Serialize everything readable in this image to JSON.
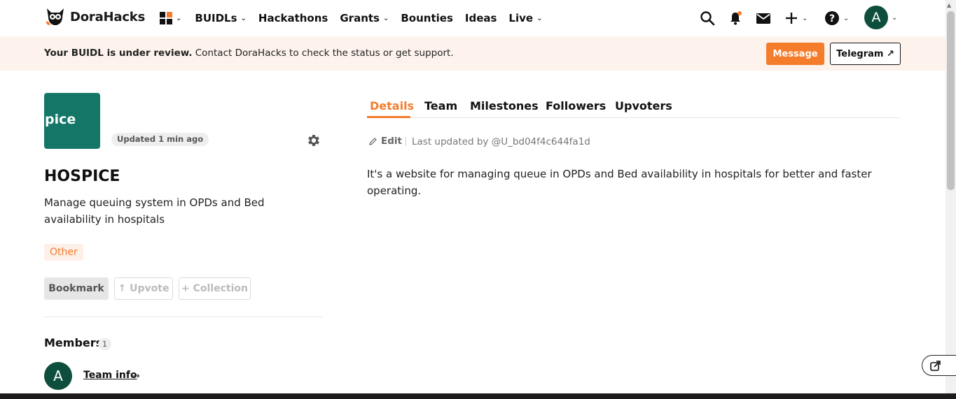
{
  "header": {
    "logo_text": "DoraHacks",
    "nav": [
      {
        "label": "BUIDLs",
        "has_dropdown": true
      },
      {
        "label": "Hackathons",
        "has_dropdown": false
      },
      {
        "label": "Grants",
        "has_dropdown": true
      },
      {
        "label": "Bounties",
        "has_dropdown": false
      },
      {
        "label": "Ideas",
        "has_dropdown": false
      },
      {
        "label": "Live",
        "has_dropdown": true
      }
    ],
    "avatar_initial": "A",
    "icons": [
      "apps-grid-icon",
      "search-icon",
      "notification-bell-icon",
      "mail-icon",
      "plus-icon",
      "help-icon"
    ]
  },
  "banner": {
    "bold_text": "Your BUIDL is under review.",
    "text": " Contact DoraHacks to check the status or get support.",
    "message_button": "Message",
    "telegram_button": "Telegram ↗"
  },
  "project": {
    "logo_text": "pice",
    "updated_badge": "Updated 1 min ago",
    "title": "HOSPICE",
    "tagline": "Manage queuing system in OPDs and Bed availability in hospitals",
    "tag": "Other",
    "buttons": {
      "bookmark": "Bookmark",
      "upvote": "↑ Upvote",
      "collection": "+ Collection"
    },
    "members_label": "Members",
    "members_count": "1",
    "member_initial": "A",
    "team_info": "Team info",
    "team_info_arrow": "→"
  },
  "details": {
    "tabs": [
      "Details",
      "Team",
      "Milestones",
      "Followers",
      "Upvoters"
    ],
    "active_tab": "Details",
    "edit_label": "Edit",
    "last_updated": "Last updated by @U_bd04f4c644fa1d",
    "description": "It's a website for managing queue in OPDs and Bed availability in hospitals for better and faster operating."
  },
  "colors": {
    "accent": "#f57c2b",
    "banner_bg": "#fdf3ec",
    "project_logo_bg": "#137666",
    "avatar_bg": "#0d4f3c"
  }
}
